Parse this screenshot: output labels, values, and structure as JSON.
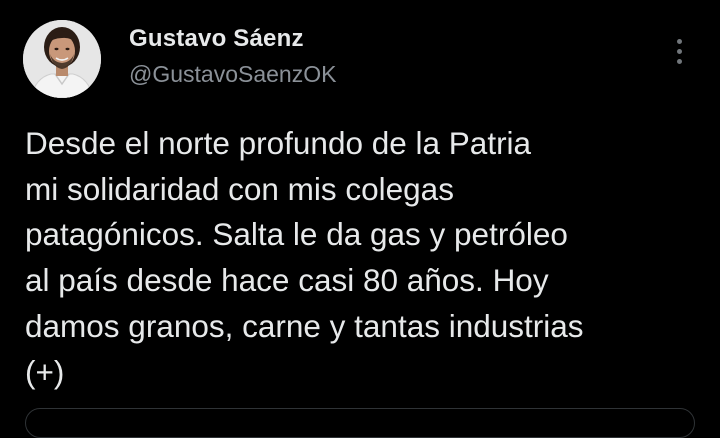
{
  "author": {
    "display_name": "Gustavo Sáenz",
    "handle": "@GustavoSaenzOK",
    "avatar_icon": "profile-photo"
  },
  "menu": {
    "icon": "more-vertical-icon"
  },
  "tweet": {
    "lines": [
      "Desde el norte profundo de la Patria",
      "mi solidaridad con mis colegas",
      "patagónicos. Salta le da gas y petróleo",
      "al país desde hace casi 80 años. Hoy",
      "damos granos, carne y tantas industrias",
      "(+)"
    ]
  },
  "colors": {
    "background": "#000000",
    "primary_text": "#e7e9ea",
    "secondary_text": "#8b9198",
    "border": "#2f3336"
  }
}
